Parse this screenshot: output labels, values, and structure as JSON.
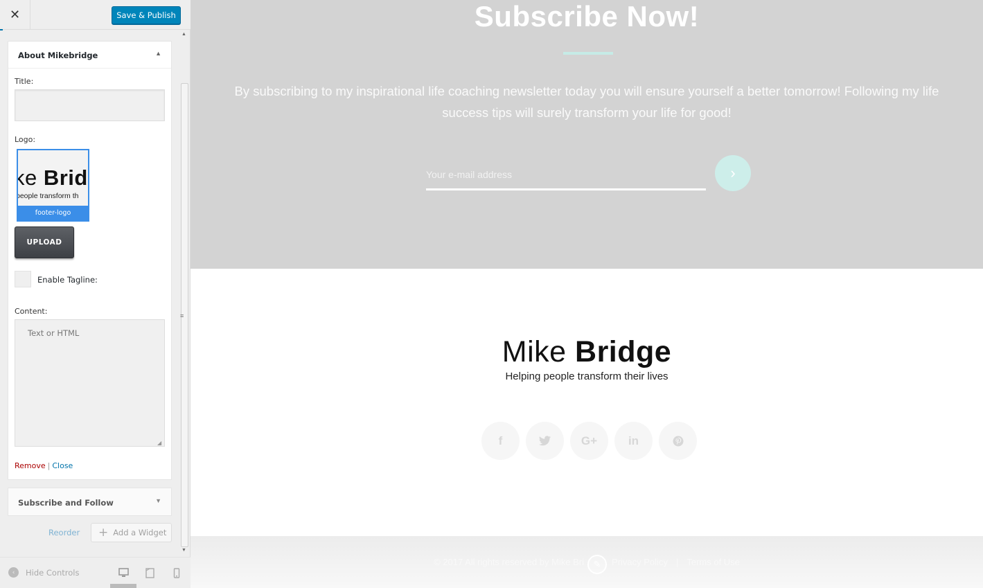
{
  "header": {
    "close_icon": "✕",
    "publish_label": "Save & Publish"
  },
  "widget": {
    "title": "About Mikebridge",
    "toggle_icon": "▲",
    "title_label": "Title:",
    "title_value": "",
    "logo_label": "Logo:",
    "logo_word_light": "ke ",
    "logo_word_bold": "Brid",
    "logo_sub": "people transform th",
    "logo_filename": "footer-logo",
    "upload_label": "UPLOAD",
    "tagline_label": "Enable Tagline:",
    "content_label": "Content:",
    "content_placeholder": "Text or HTML",
    "remove_label": "Remove",
    "separator": "|",
    "close_label": "Close"
  },
  "widget2": {
    "title": "Subscribe and Follow",
    "toggle_icon": "▼"
  },
  "widget_controls": {
    "reorder_label": "Reorder",
    "add_widget_label": "Add a Widget",
    "add_icon": "+"
  },
  "footer_controls": {
    "hide_label": "Hide Controls",
    "hide_icon": "‹",
    "desktop_icon": "🖥",
    "tablet_icon": "▯",
    "mobile_icon": "▮"
  },
  "preview": {
    "subscribe_title": "Subscribe Now!",
    "subscribe_text": "By subscribing to my inspirational life coaching newsletter today you will ensure yourself a better tomorrow! Following my life success tips will surely transform your life for good!",
    "email_placeholder": "Your e-mail address",
    "submit_icon": "›",
    "brand_light": "Mike ",
    "brand_bold": "Bridge",
    "brand_tagline": "Helping people transform their lives",
    "social": [
      {
        "icon": "f",
        "name": "facebook-icon"
      },
      {
        "icon": "🐦",
        "name": "twitter-icon"
      },
      {
        "icon": "G+",
        "name": "google-plus-icon"
      },
      {
        "icon": "in",
        "name": "linkedin-icon"
      },
      {
        "icon": "℗",
        "name": "pinterest-icon"
      }
    ],
    "footer_copyright": "© 2017 All rights reserved by Mike Bri",
    "footer_privacy": "Privacy Policy",
    "footer_divider": "|",
    "footer_terms": "Terms of Use",
    "edit_icon": "✎"
  },
  "colors": {
    "accent": "#0085ba",
    "subscribe_bg": "#d3d3d3",
    "mint": "#cdeeea",
    "remove": "#aa0000",
    "link": "#0073aa"
  }
}
